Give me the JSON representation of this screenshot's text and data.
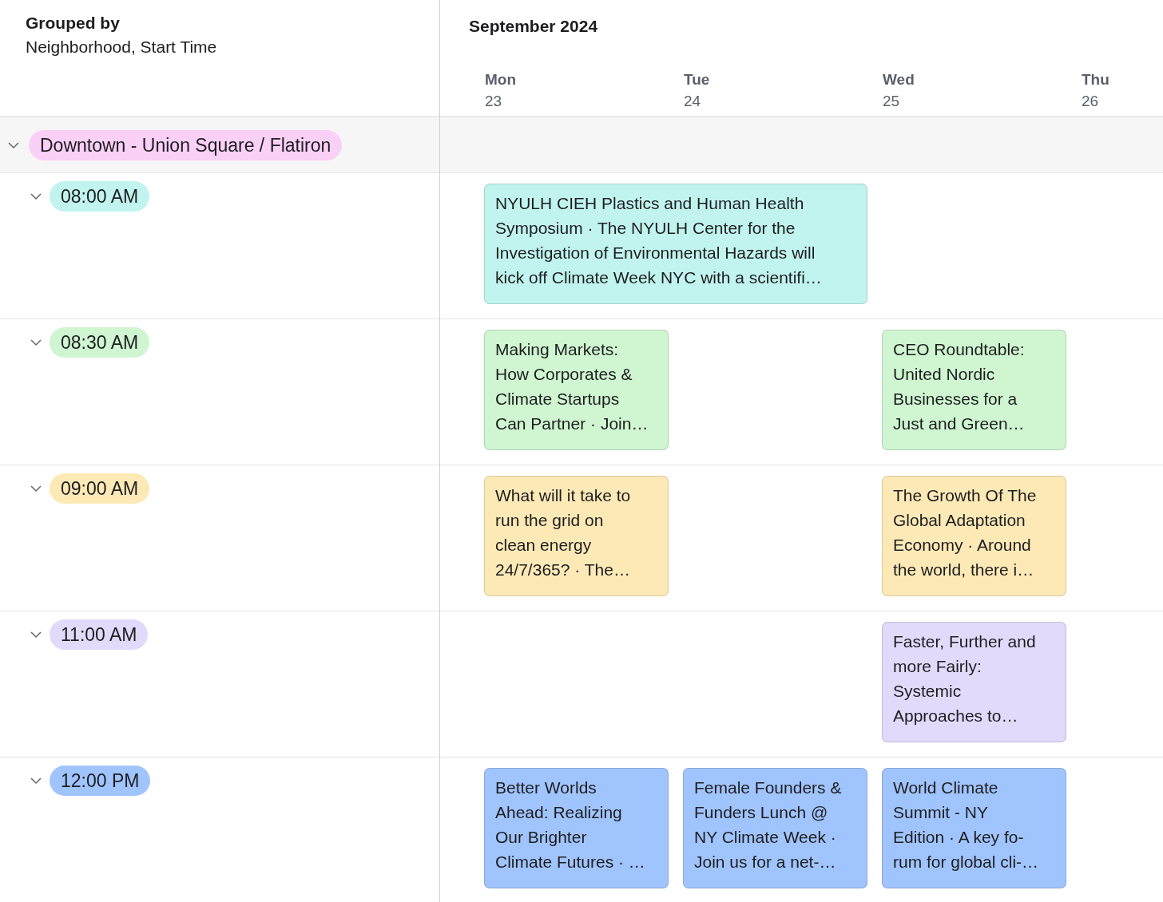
{
  "grouping": {
    "title": "Grouped by",
    "fields": "Neighborhood, Start Time"
  },
  "calendar": {
    "month": "September 2024",
    "days": [
      {
        "weekday": "Mon",
        "date": "23"
      },
      {
        "weekday": "Tue",
        "date": "24"
      },
      {
        "weekday": "Wed",
        "date": "25"
      },
      {
        "weekday": "Thu",
        "date": "26"
      }
    ]
  },
  "group": {
    "label": "Downtown - Union Square / Flatiron",
    "color": "#fad0f7",
    "expanded": true
  },
  "rows": [
    {
      "time": "08:00 AM",
      "color": "#c1f4ef",
      "expanded": true,
      "slots": [
        {
          "kind": "two-day",
          "lines": [
            "NYULH CIEH Plastics and Human Health",
            "Symposium  · The NYULH Center for the",
            "Investigation of Environmental Hazards will",
            "kick off Climate Week NYC with a scientifi…"
          ]
        }
      ]
    },
    {
      "time": "08:30 AM",
      "color": "#cff5d1",
      "expanded": true,
      "slots": [
        {
          "kind": "event",
          "lines": [
            "Making Markets:",
            "How Corporates &",
            "Climate Startups",
            "Can Partner · Join…"
          ]
        },
        {
          "kind": "empty"
        },
        {
          "kind": "event",
          "lines": [
            "CEO Roundtable:",
            "United Nordic",
            "Businesses for a",
            "Just and Green…"
          ]
        }
      ]
    },
    {
      "time": "09:00 AM",
      "color": "#fde9b6",
      "expanded": true,
      "slots": [
        {
          "kind": "event",
          "lines": [
            "What will it take to",
            "run the grid on",
            "clean energy",
            "24/7/365? · The…"
          ]
        },
        {
          "kind": "empty"
        },
        {
          "kind": "event",
          "lines": [
            "The Growth Of The",
            "Global Adaptation",
            "Economy · Around",
            "the world, there i…"
          ]
        }
      ]
    },
    {
      "time": "11:00 AM",
      "color": "#e1dafb",
      "expanded": true,
      "slots": [
        {
          "kind": "empty"
        },
        {
          "kind": "empty"
        },
        {
          "kind": "event",
          "lines": [
            "Faster, Further and",
            "more Fairly:",
            "Systemic",
            "Approaches to…"
          ]
        }
      ]
    },
    {
      "time": "12:00 PM",
      "color": "#a0c4fd",
      "expanded": true,
      "slots": [
        {
          "kind": "event",
          "lines": [
            "Better Worlds",
            "Ahead: Realizing",
            "Our Brighter",
            "Climate Futures · …"
          ]
        },
        {
          "kind": "event",
          "lines": [
            "Female Founders &",
            "Funders Lunch @",
            "NY Climate Week ·",
            "Join us for a net-…"
          ]
        },
        {
          "kind": "event",
          "lines": [
            "World Climate",
            "Summit - NY",
            "Edition · A key fo-",
            "rum for global cli-…"
          ]
        }
      ]
    }
  ]
}
